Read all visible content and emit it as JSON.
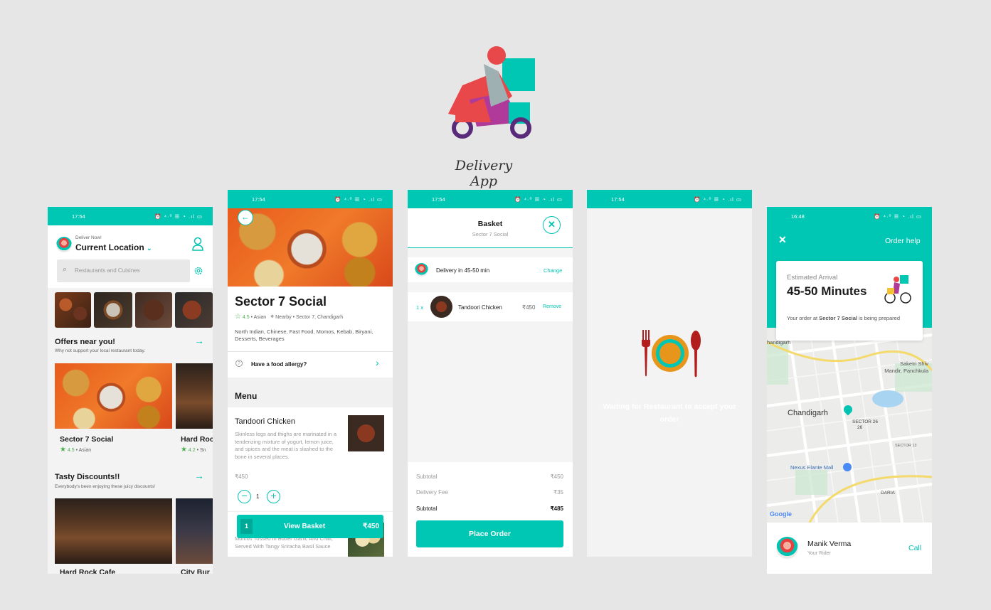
{
  "brand": {
    "title": "Delivery App"
  },
  "status": {
    "time1": "17:54",
    "time2": "16:48",
    "icons": "⏰ ⁴·⁰ ☰ ◔ .ıl ▭"
  },
  "home": {
    "deliver_label": "Deliver Now!",
    "location": "Current Location",
    "search_placeholder": "Restaurants and Cuisines",
    "offers_title": "Offers near you!",
    "offers_sub": "Why not support your local restaurant today.",
    "card1_name": "Sector 7 Social",
    "card1_rating": "4.5",
    "card1_cuisine": "• Asian",
    "card2_name": "Hard Rock",
    "card2_rating": "4.2",
    "card2_cuisine": "• Sn",
    "discounts_title": "Tasty Discounts!!",
    "discounts_sub": "Everybody's been enjoying these juicy discounts!",
    "card3_name": "Hard Rock Cafe",
    "card4_name": "City Bur"
  },
  "restaurant": {
    "name": "Sector 7 Social",
    "rating": "4.5",
    "cuisine": "• Asian",
    "location": "Nearby • Sector 7, Chandigarh",
    "tags": "North Indian, Chinese, Fast Food, Momos, Kebab, Biryani, Desserts, Beverages",
    "allergy": "Have a food allergy?",
    "menu_title": "Menu",
    "item_name": "Tandoori Chicken",
    "item_desc": "Skinless legs and thighs are marinated in a tenderizing mixture of yogurt, lemon juice, and spices and the meat is slashed to the bone in several places.",
    "item_price": "₹450",
    "qty": "1",
    "item2_desc": "Momos Tossed In Butter Garlic And Chilli, Served With Tangy Sriracha Basil Sauce",
    "basket_count": "1",
    "basket_label": "View Basket",
    "basket_total": "₹450"
  },
  "basket": {
    "title": "Basket",
    "subtitle": "Sector 7 Social",
    "delivery": "Delivery in 45-50 min",
    "change": "Change",
    "qty": "1 x",
    "item": "Tandoori Chicken",
    "price": "₹450",
    "remove": "Remove",
    "subtotal_label": "Subtotal",
    "subtotal": "₹450",
    "fee_label": "Delivery Fee",
    "fee": "₹35",
    "total_label": "Subtotal",
    "total": "₹485",
    "place_order": "Place Order"
  },
  "waiting": {
    "message": "Waiting for Restaurant to accept your order"
  },
  "tracking": {
    "help": "Order help",
    "eta_label": "Estimated Arrival",
    "eta": "45-50 Minutes",
    "status_prefix": "Your order at ",
    "status_restaurant": "Sector 7 Social",
    "status_suffix": " is being prepared",
    "map_city": "Chandigarh",
    "map_chandigarh": "handigarh",
    "map_saketri": "Saketri Shiv Mandir, Panchkula",
    "map_sector26": "SECTOR 26",
    "map_sector26b": "26",
    "map_sector13": "SECTOR 13",
    "map_nexus": "Nexus Elante Mall",
    "map_daria": "DARIA",
    "map_google": "Google",
    "rider_name": "Manik Verma",
    "rider_role": "Your Rider",
    "call": "Call"
  }
}
